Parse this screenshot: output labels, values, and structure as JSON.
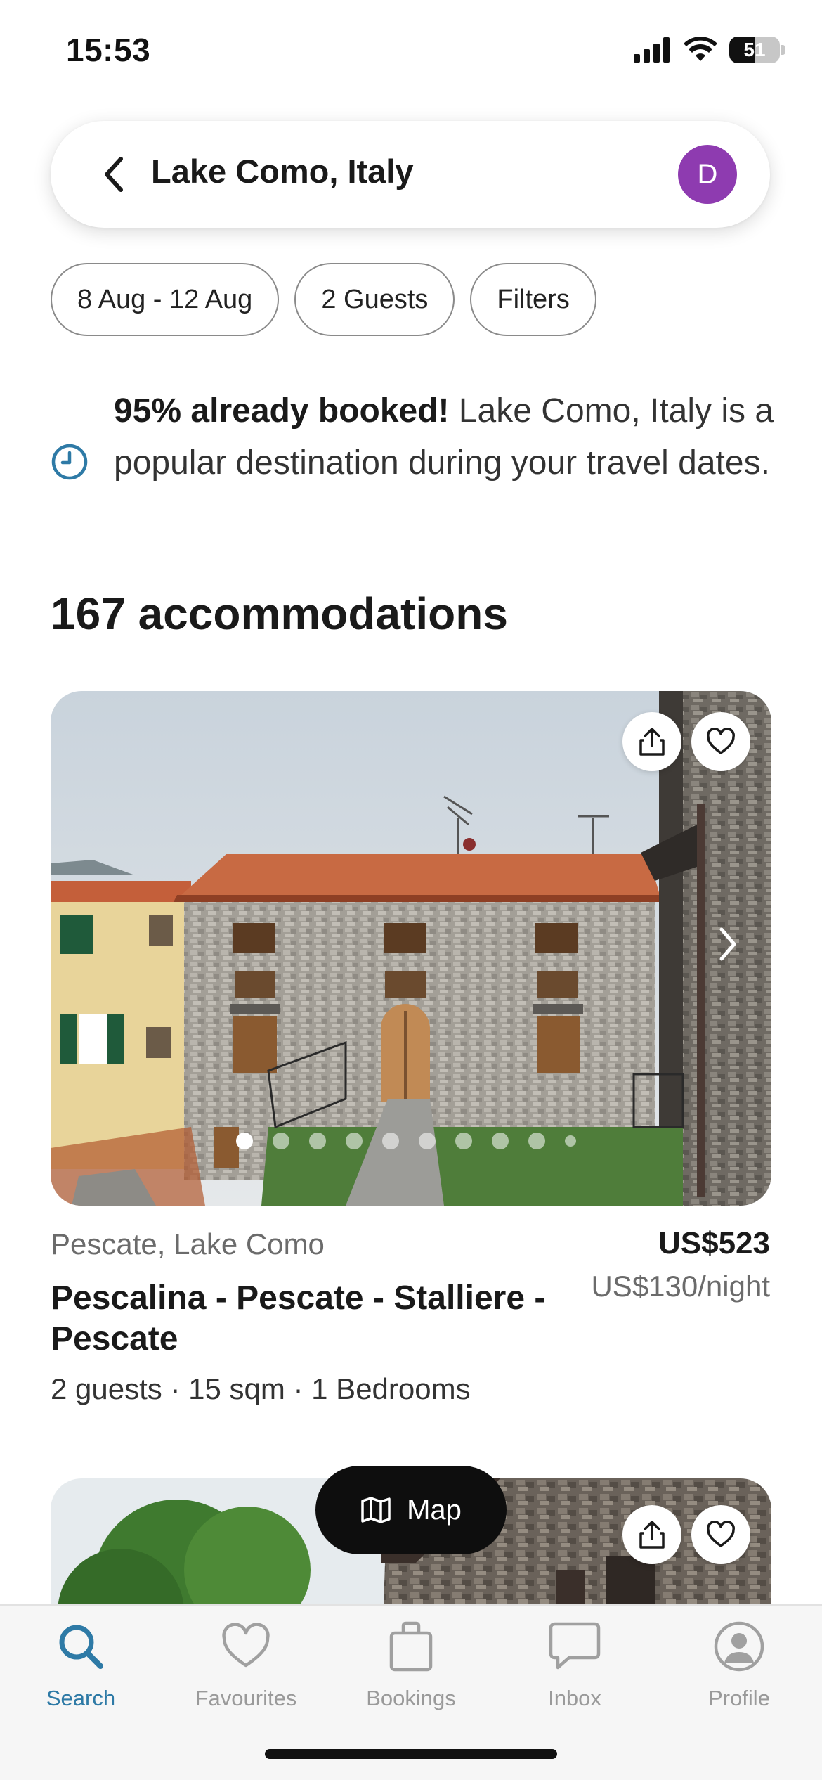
{
  "status_bar": {
    "time": "15:53",
    "battery": "51",
    "battery_level": 0.51
  },
  "search": {
    "back_label": "Back",
    "title": "Lake Como, Italy",
    "avatar_initial": "D",
    "avatar_color": "#8e3bb0"
  },
  "chips": [
    {
      "label": "8 Aug - 12 Aug"
    },
    {
      "label": "2 Guests"
    },
    {
      "label": "Filters"
    }
  ],
  "notice": {
    "icon": "clock-icon",
    "bold": "95% already booked!",
    "text": " Lake Como, Italy is a popular destination during your travel dates.",
    "icon_color": "#2e7aa6"
  },
  "results": {
    "count_label": "167 accommodations"
  },
  "listings": [
    {
      "location": "Pescate, Lake Como",
      "total_price": "US$523",
      "nightly_price": "US$130/night",
      "title": "Pescalina - Pescate - Stalliere - Pescate",
      "meta": "2  guests · 15 sqm · 1 Bedrooms",
      "photo_count": 10,
      "active_photo": 0
    }
  ],
  "map_button": {
    "label": "Map"
  },
  "tabs": [
    {
      "label": "Search",
      "icon": "search-icon",
      "active": true
    },
    {
      "label": "Favourites",
      "icon": "heart-icon",
      "active": false
    },
    {
      "label": "Bookings",
      "icon": "bag-icon",
      "active": false
    },
    {
      "label": "Inbox",
      "icon": "chat-icon",
      "active": false
    },
    {
      "label": "Profile",
      "icon": "profile-icon",
      "active": false
    }
  ],
  "colors": {
    "accent": "#2e7aa6",
    "text": "#222222",
    "muted": "#6b6b6b"
  }
}
